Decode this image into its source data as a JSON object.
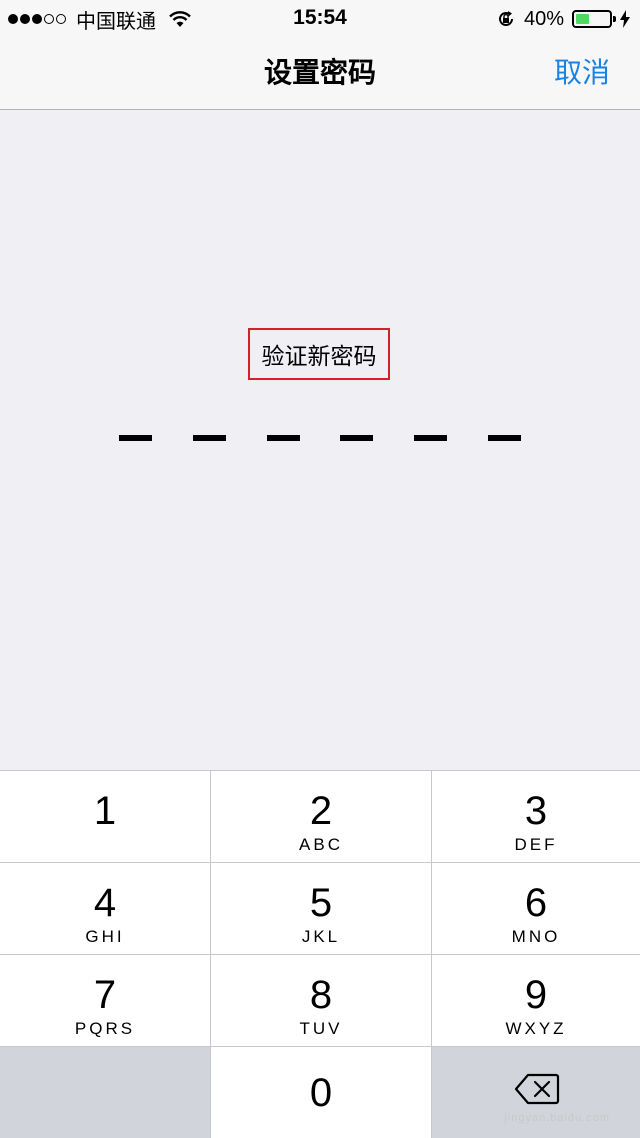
{
  "status_bar": {
    "signal_strength": 3,
    "signal_max": 5,
    "carrier": "中国联通",
    "time": "15:54",
    "battery": "40%",
    "battery_level": 0.4,
    "icons": [
      "wifi-icon",
      "rotation-lock-icon",
      "battery-icon",
      "charging-icon"
    ]
  },
  "navbar": {
    "title": "设置密码",
    "cancel_label": "取消"
  },
  "content": {
    "prompt": "验证新密码",
    "passcode_length": 6
  },
  "keypad": {
    "keys": [
      {
        "num": "1",
        "letters": ""
      },
      {
        "num": "2",
        "letters": "ABC"
      },
      {
        "num": "3",
        "letters": "DEF"
      },
      {
        "num": "4",
        "letters": "GHI"
      },
      {
        "num": "5",
        "letters": "JKL"
      },
      {
        "num": "6",
        "letters": "MNO"
      },
      {
        "num": "7",
        "letters": "PQRS"
      },
      {
        "num": "8",
        "letters": "TUV"
      },
      {
        "num": "9",
        "letters": "WXYZ"
      },
      {
        "num": "0",
        "letters": ""
      }
    ],
    "delete_icon": "delete-backspace-icon"
  },
  "watermark": "jingyan.baidu.com",
  "colors": {
    "accent": "#1a82e2",
    "highlight_box": "#d81e2e",
    "battery_fill": "#4cd964",
    "background": "#efeff4"
  }
}
